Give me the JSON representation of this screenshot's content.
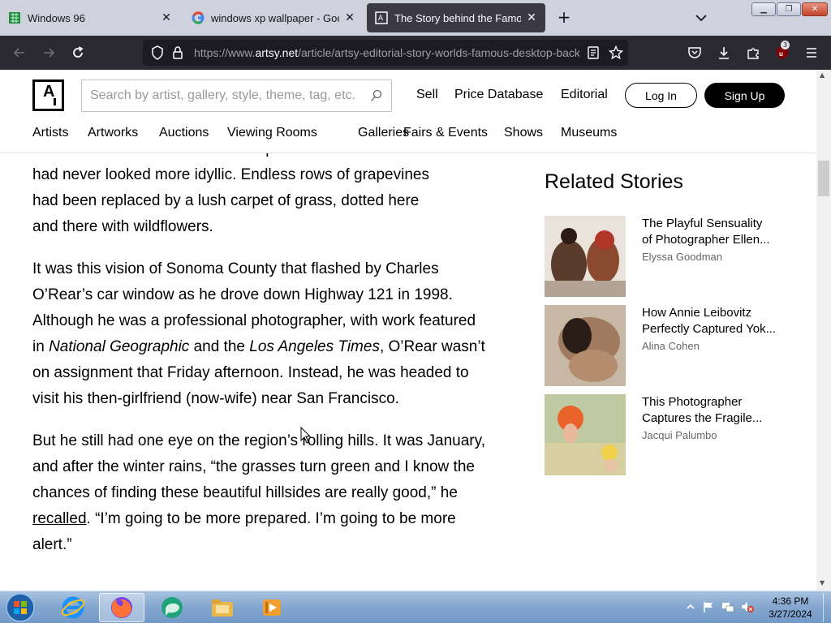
{
  "browser": {
    "tabs": [
      {
        "title": "Windows 96",
        "favicon": "spreadsheet-icon",
        "active": false
      },
      {
        "title": "windows xp wallpaper - Google",
        "favicon": "google-icon",
        "active": false
      },
      {
        "title": "The Story behind the Famous W",
        "favicon": "artsy-icon",
        "active": true
      }
    ],
    "url_prefix": "https://www.",
    "url_host": "artsy.net",
    "url_path": "/article/artsy-editorial-story-worlds-famous-desktop-background",
    "extension_badge": "3"
  },
  "site": {
    "logo_letter": "A",
    "search_placeholder": "Search by artist, gallery, style, theme, tag, etc.",
    "top_links": [
      "Sell",
      "Price Database",
      "Editorial"
    ],
    "login_label": "Log In",
    "signup_label": "Sign Up",
    "nav": [
      "Artists",
      "Artworks",
      "Auctions",
      "Viewing Rooms",
      "Galleries",
      "Fairs & Events",
      "Shows",
      "Museums"
    ]
  },
  "article": {
    "p0_lines": [
      "billion dollars in total—the landscape of Northern California",
      "had never looked more idyllic. Endless rows of grapevines",
      "had been replaced by a lush carpet of grass, dotted here",
      "and there with wildflowers."
    ],
    "p1_a": "It was this vision of Sonoma County that flashed by Charles O’Rear’s car window as he drove down Highway 121 in 1998. Although he was a professional photographer, with work featured in ",
    "p1_em1": "National Geographic",
    "p1_b": " and the ",
    "p1_em2": "Los Angeles Times",
    "p1_c": ", O’Rear wasn’t on assignment that Friday afternoon. Instead, he was headed to visit his then-girlfriend (now-wife) near San Francisco.",
    "p2_a": "But he still had one eye on the region’s rolling hills. It was January, and after the winter rains, “the grasses turn green and I know the chances of finding these beautiful hillsides are really good,” he ",
    "p2_link": "recalled",
    "p2_b": ". “I’m going to be more prepared. I’m going to be more alert.”"
  },
  "related": {
    "title": "Related Stories",
    "items": [
      {
        "line1": "The Playful Sensuality",
        "line2": "of Photographer Ellen...",
        "author": "Elyssa Goodman"
      },
      {
        "line1": "How Annie Leibovitz",
        "line2": "Perfectly Captured Yok...",
        "author": "Alina Cohen"
      },
      {
        "line1": "This Photographer",
        "line2": "Captures the Fragile...",
        "author": "Jacqui Palumbo"
      }
    ]
  },
  "taskbar": {
    "time": "4:36 PM",
    "date": "3/27/2024"
  },
  "colors": {
    "tabstrip": "#cfd2dc",
    "toolbar": "#2b2a33",
    "urlbar": "#1c1b22",
    "taskbar": "#86a8d0"
  }
}
